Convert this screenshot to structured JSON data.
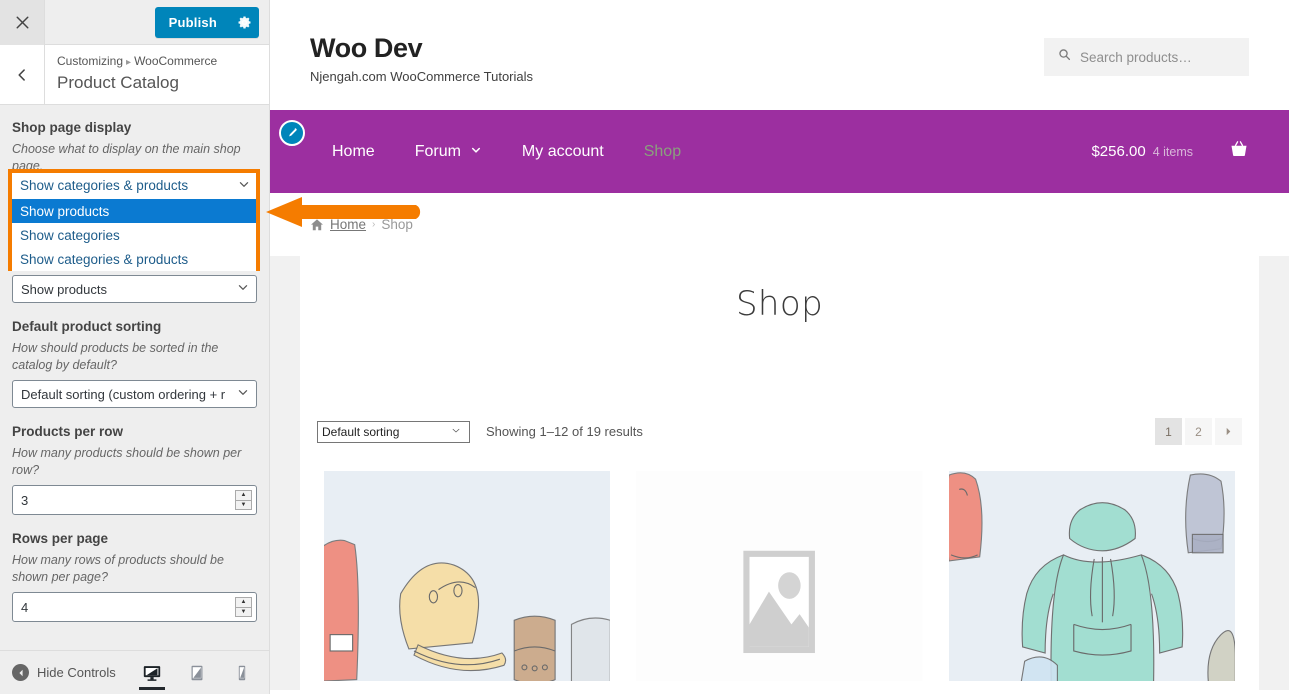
{
  "customizer": {
    "close_icon": "close-icon",
    "publish_label": "Publish",
    "gear_icon": "gear-icon",
    "back_icon": "chevron-left-icon",
    "breadcrumb": {
      "root": "Customizing",
      "separator": "▸",
      "section": "WooCommerce"
    },
    "panel_title": "Product Catalog",
    "controls": [
      {
        "label": "Shop page display",
        "description": "Choose what to display on the main shop page.",
        "type": "select-open",
        "value": "Show categories & products",
        "options": [
          "Show products",
          "Show categories",
          "Show categories & products"
        ],
        "selected_option": "Show products",
        "underlying_value": "Show products"
      },
      {
        "label": "Default product sorting",
        "description": "How should products be sorted in the catalog by default?",
        "type": "select",
        "value": "Default sorting (custom ordering + r"
      },
      {
        "label": "Products per row",
        "description": "How many products should be shown per row?",
        "type": "number",
        "value": "3"
      },
      {
        "label": "Rows per page",
        "description": "How many rows of products should be shown per page?",
        "type": "number",
        "value": "4"
      }
    ],
    "footer": {
      "hide_controls_label": "Hide Controls",
      "devices": [
        {
          "name": "desktop",
          "active": true
        },
        {
          "name": "tablet",
          "active": false
        },
        {
          "name": "mobile",
          "active": false
        }
      ]
    }
  },
  "preview": {
    "site": {
      "title": "Woo Dev",
      "tagline": "Njengah.com WooCommerce Tutorials"
    },
    "search": {
      "placeholder": "Search products…",
      "icon": "search-icon"
    },
    "nav": {
      "edit_icon": "pencil-edit-icon",
      "items": [
        {
          "label": "Home",
          "has_caret": false,
          "dim": false
        },
        {
          "label": "Forum",
          "has_caret": true,
          "dim": false
        },
        {
          "label": "My account",
          "has_caret": false,
          "dim": false
        },
        {
          "label": "Shop",
          "has_caret": false,
          "dim": true
        }
      ],
      "cart": {
        "amount": "$256.00",
        "items": "4 items",
        "icon": "basket-icon"
      }
    },
    "breadcrumb": {
      "home": "Home",
      "separator": "›",
      "current": "Shop",
      "home_icon": "home-icon"
    },
    "page": {
      "title": "Shop",
      "sorting_value": "Default sorting",
      "showing_text": "Showing 1–12 of 19 results",
      "pagination": [
        "1",
        "2"
      ],
      "pagination_next_icon": "next-page-icon",
      "current_page": "1"
    },
    "colors": {
      "nav_bg": "#9c2fa0",
      "publish_bg": "#0085ba",
      "highlight_orange": "#f57c00",
      "option_selected_blue": "#0b7ad1"
    }
  },
  "annotation": {
    "arrow_icon": "left-pointing-arrow",
    "color": "#f57c00"
  }
}
